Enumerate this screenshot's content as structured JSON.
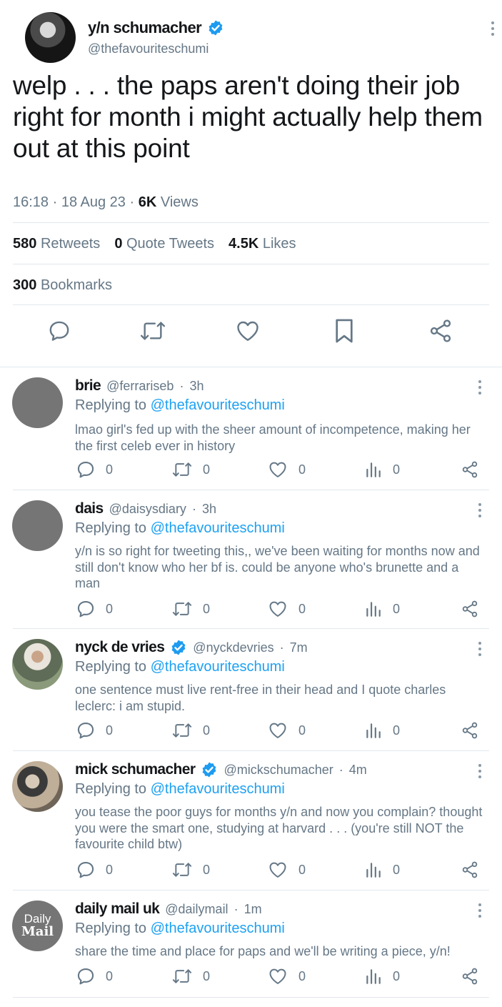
{
  "main_tweet": {
    "display_name": "y/n schumacher",
    "handle": "@thefavouriteschumi",
    "text": "welp . . . the paps aren't doing their job right for month i might actually help them out at this point",
    "time": "16:18",
    "date": "18 Aug 23",
    "views_count": "6K",
    "views_label": "Views",
    "retweets_count": "580",
    "retweets_label": "Retweets",
    "quotes_count": "0",
    "quotes_label": "Quote Tweets",
    "likes_count": "4.5K",
    "likes_label": "Likes",
    "bookmarks_count": "300",
    "bookmarks_label": "Bookmarks"
  },
  "replies": [
    {
      "display_name": "brie",
      "handle": "@ferrariseb",
      "age": "3h",
      "verified": false,
      "replying_prefix": "Replying to",
      "replying_to": "@thefavouriteschumi",
      "text": "lmao girl's fed up with the sheer amount of incompetence, making her the first celeb ever in history",
      "reply_count": "0",
      "retweet_count": "0",
      "like_count": "0",
      "view_count": "0"
    },
    {
      "display_name": "dais",
      "handle": "@daisysdiary",
      "age": "3h",
      "verified": false,
      "replying_prefix": "Replying to",
      "replying_to": "@thefavouriteschumi",
      "text": "y/n is so right for tweeting this,, we've been waiting for months now and still don't know who her bf is. could be anyone who's brunette and a man",
      "reply_count": "0",
      "retweet_count": "0",
      "like_count": "0",
      "view_count": "0"
    },
    {
      "display_name": "nyck de vries",
      "handle": "@nyckdevries",
      "age": "7m",
      "verified": true,
      "replying_prefix": "Replying to",
      "replying_to": "@thefavouriteschumi",
      "text": "one sentence must live rent-free in their head and I quote charles leclerc: i am stupid.",
      "reply_count": "0",
      "retweet_count": "0",
      "like_count": "0",
      "view_count": "0"
    },
    {
      "display_name": "mick schumacher",
      "handle": "@mickschumacher",
      "age": "4m",
      "verified": true,
      "replying_prefix": "Replying to",
      "replying_to": "@thefavouriteschumi",
      "text": "you tease the poor guys for months y/n and now you complain? thought you were the smart one, studying at harvard . . . (you're still NOT the favourite child btw)",
      "reply_count": "0",
      "retweet_count": "0",
      "like_count": "0",
      "view_count": "0"
    },
    {
      "display_name": "daily mail uk",
      "handle": "@dailymail",
      "age": "1m",
      "verified": false,
      "avatar_text_1": "Daily",
      "avatar_text_2": "Mail",
      "replying_prefix": "Replying to",
      "replying_to": "@thefavouriteschumi",
      "text": "share the time and place for paps and we'll be writing a piece, y/n!",
      "reply_count": "0",
      "retweet_count": "0",
      "like_count": "0",
      "view_count": "0"
    }
  ],
  "colors": {
    "accent": "#1da1f2",
    "muted_text": "#657786",
    "divider": "#e1e8ed",
    "icon": "#657786",
    "verified": "#1d9bf0"
  },
  "icons": {
    "reply": "reply-icon",
    "retweet": "retweet-icon",
    "like": "heart-icon",
    "bookmark": "bookmark-icon",
    "share": "share-icon",
    "views": "views-icon",
    "more": "more-icon",
    "verified": "verified-badge-icon"
  }
}
